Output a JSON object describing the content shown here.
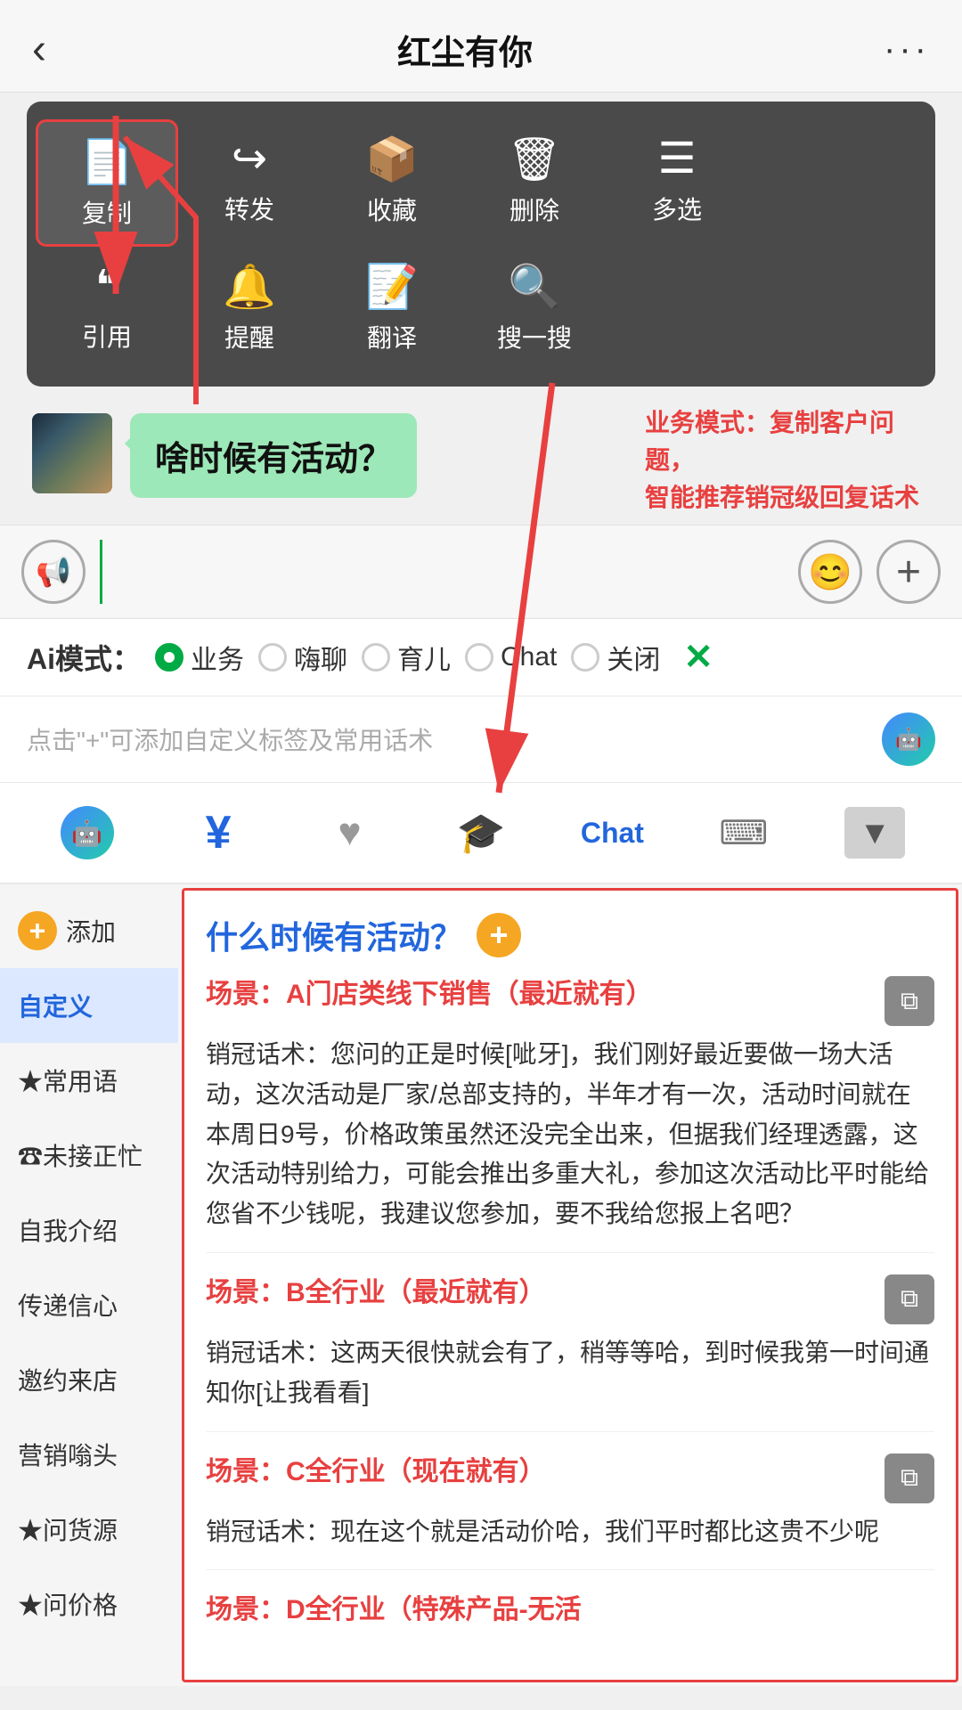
{
  "nav": {
    "back_icon": "‹",
    "title": "红尘有你",
    "more_icon": "···"
  },
  "context_menu": {
    "row1": [
      {
        "icon": "📄",
        "label": "复制",
        "highlighted": true
      },
      {
        "icon": "↪",
        "label": "转发",
        "highlighted": false
      },
      {
        "icon": "📦",
        "label": "收藏",
        "highlighted": false
      },
      {
        "icon": "🗑",
        "label": "删除",
        "highlighted": false
      },
      {
        "icon": "☰",
        "label": "多选",
        "highlighted": false
      }
    ],
    "row2": [
      {
        "icon": "❝",
        "label": "引用",
        "highlighted": false
      },
      {
        "icon": "🔔",
        "label": "提醒",
        "highlighted": false
      },
      {
        "icon": "📝",
        "label": "翻译",
        "highlighted": false
      },
      {
        "icon": "🔍",
        "label": "搜一搜",
        "highlighted": false
      }
    ]
  },
  "chat": {
    "bubble_text": "啥时候有活动？",
    "annotation": "业务模式：复制客户问题，\n智能推荐销冠级回复话术"
  },
  "input": {
    "placeholder": "",
    "voice_icon": "🎙",
    "emoji_icon": "😊",
    "add_icon": "+"
  },
  "ai_modes": {
    "label": "Ai模式：",
    "options": [
      {
        "label": "业务",
        "active": true
      },
      {
        "label": "嗨聊",
        "active": false
      },
      {
        "label": "育儿",
        "active": false
      },
      {
        "label": "Chat",
        "active": false
      },
      {
        "label": "关闭",
        "active": false
      }
    ],
    "close_icon": "✕"
  },
  "hint": {
    "text": "点击\"+\"可添加自定义标签及常用话术"
  },
  "tools": [
    {
      "icon": "🤖",
      "type": "chat",
      "active": false
    },
    {
      "icon": "¥",
      "type": "blue",
      "active": false
    },
    {
      "icon": "♥",
      "type": "gray",
      "active": false
    },
    {
      "icon": "🎓",
      "type": "gray",
      "active": false
    },
    {
      "icon": "Chat",
      "type": "text-blue",
      "active": false
    },
    {
      "icon": "⌨",
      "type": "gray",
      "active": false
    },
    {
      "icon": "▼",
      "type": "dropdown",
      "active": false
    }
  ],
  "sidebar": {
    "add_label": "添加",
    "items": [
      {
        "label": "自定义",
        "active": true
      },
      {
        "label": "★常用语",
        "active": false
      },
      {
        "label": "☎未接正忙",
        "active": false
      },
      {
        "label": "自我介绍",
        "active": false
      },
      {
        "label": "传递信心",
        "active": false
      },
      {
        "label": "邀约来店",
        "active": false
      },
      {
        "label": "营销嗡头",
        "active": false
      },
      {
        "label": "★问货源",
        "active": false
      },
      {
        "label": "★问价格",
        "active": false
      }
    ]
  },
  "right_panel": {
    "question": "什么时候有活动？",
    "scenes": [
      {
        "scene_label": "场景：A门店类线下销售（最近就有）",
        "script": "销冠话术：您问的正是时候[呲牙]，我们刚好最近要做一场大活动，这次活动是厂家/总部支持的，半年才有一次，活动时间就在本周日9号，价格政策虽然还没完全出来，但据我们经理透露，这次活动特别给力，可能会推出多重大礼，参加这次活动比平时能给您省不少钱呢，我建议您参加，要不我给您报上名吧？"
      },
      {
        "scene_label": "场景：B全行业（最近就有）",
        "script": "销冠话术：这两天很快就会有了，稍等等哈，到时候我第一时间通知你[让我看看]"
      },
      {
        "scene_label": "场景：C全行业（现在就有）",
        "script": "销冠话术：现在这个就是活动价哈，我们平时都比这贵不少呢"
      },
      {
        "scene_label": "场景：D全行业（特殊产品-无活",
        "script": ""
      }
    ]
  }
}
